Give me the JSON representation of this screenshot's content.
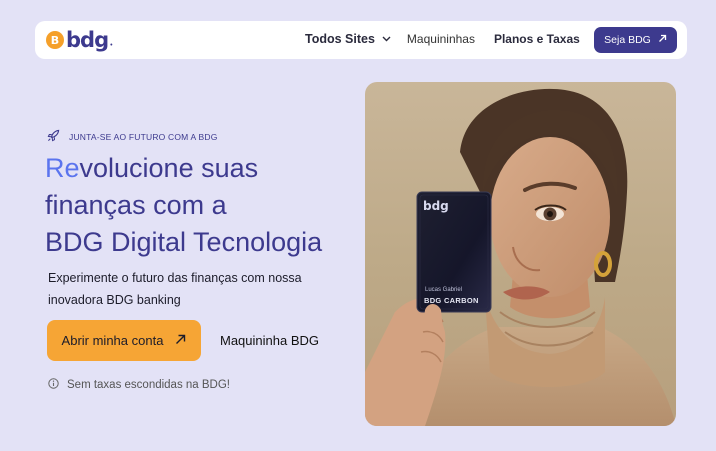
{
  "brand": {
    "logo_text": "bdg",
    "coin_symbol": "B"
  },
  "nav": {
    "items": [
      {
        "label": "Todos Sites",
        "has_dropdown": true
      },
      {
        "label": "Maquininhas"
      },
      {
        "label": "Planos e Taxas"
      }
    ],
    "cta_label": "Seja BDG"
  },
  "hero": {
    "eyebrow": "JUNTA-SE AO FUTURO COM A BDG",
    "headline_accent": "Re",
    "headline_line1_rest": "volucione suas",
    "headline_line2": "finanças com a",
    "headline_line3": "BDG Digital Tecnologia",
    "subtext": "Experimente o futuro das finanças com nossa inovadora BDG banking",
    "primary_button": "Abrir minha conta",
    "secondary_button": "Maquininha BDG",
    "notice": "Sem taxas escondidas na BDG!"
  },
  "card": {
    "brand": "bdg",
    "holder": "Lucas Gabriel",
    "product": "BDG CARBON"
  },
  "colors": {
    "background": "#e3e2f6",
    "brand_primary": "#3d3a8e",
    "accent_orange": "#f6a535",
    "headline_accent": "#5b74ee"
  },
  "icons": {
    "nav_chevron": "chevron-down-icon",
    "cta_arrow": "arrow-up-right-icon",
    "eyebrow": "rocket-icon",
    "notice": "info-icon"
  }
}
